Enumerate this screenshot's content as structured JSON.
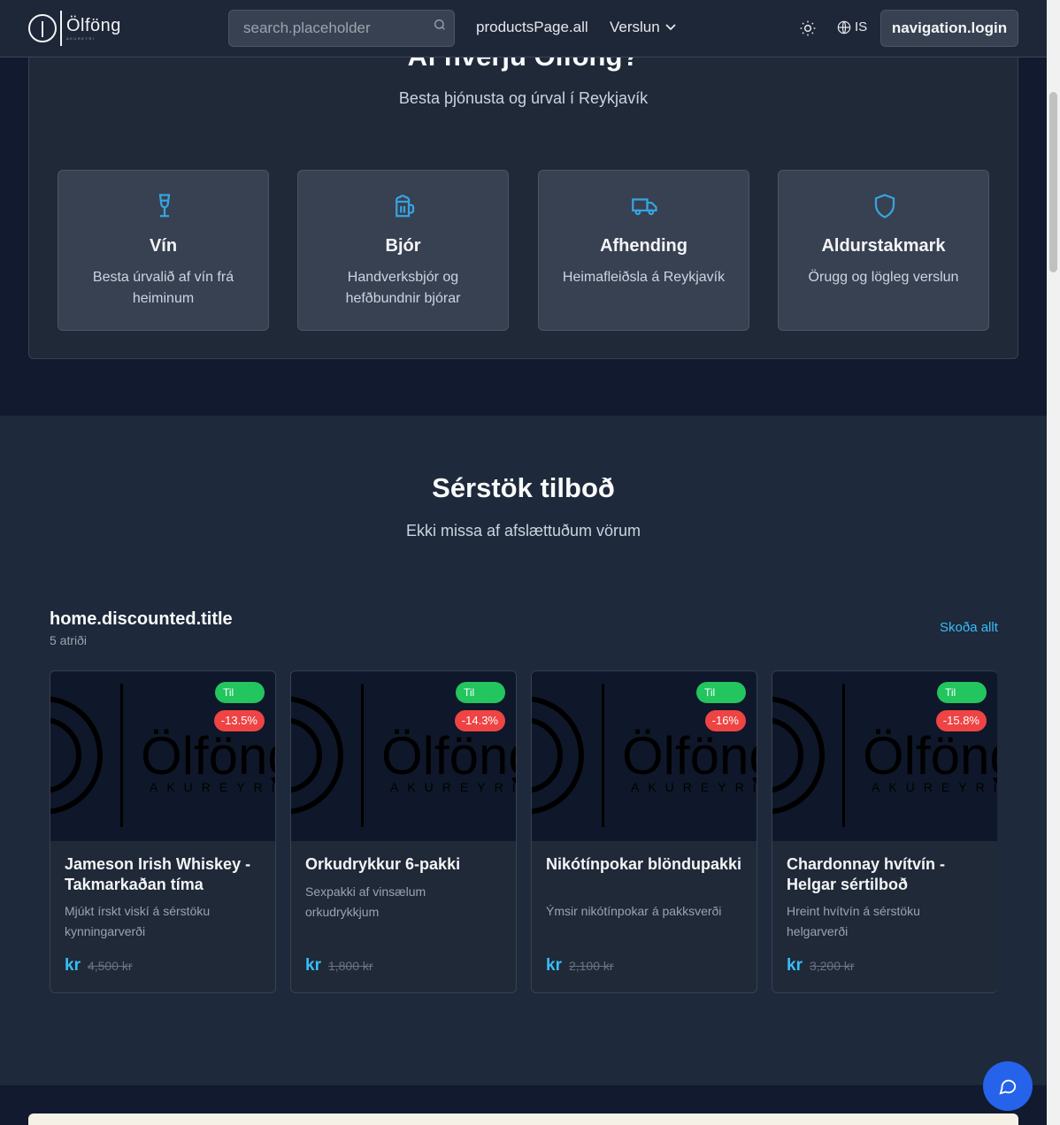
{
  "header": {
    "logo_text": "Ölföng",
    "logo_sub": "AKUREYRI",
    "search_placeholder": "search.placeholder",
    "nav_all": "productsPage.all",
    "nav_shop": "Verslun",
    "lang": "IS",
    "login": "navigation.login",
    "icons": [
      "search-icon",
      "chevron-down-icon",
      "sun-icon",
      "globe-icon"
    ]
  },
  "why": {
    "title": "Af hverju Ölföng?",
    "subtitle": "Besta þjónusta og úrval í Reykjavík",
    "features": [
      {
        "title": "Vín",
        "desc": "Besta úrvalið af vín frá heiminum",
        "icon": "wine-glass-icon"
      },
      {
        "title": "Bjór",
        "desc": "Handverksbjór og hefðbundnir bjórar",
        "icon": "beer-mug-icon"
      },
      {
        "title": "Afhending",
        "desc": "Heimafleiðsla á Reykjavík",
        "icon": "truck-icon"
      },
      {
        "title": "Aldurstakmark",
        "desc": "Örugg og lögleg verslun",
        "icon": "shield-icon"
      }
    ],
    "accent_color": "#38a3e0"
  },
  "offers": {
    "title": "Sérstök tilboð",
    "subtitle": "Ekki missa af afslættuðum vörum",
    "section_title": "home.discounted.title",
    "count": "5 atriði",
    "view_all": "Skoða allt",
    "products": [
      {
        "stock": "Til",
        "discount": "-13.5%",
        "name": "Jameson Irish Whiskey - Takmarkaðan tíma",
        "desc": "Mjúkt írskt viskí á sérstöku kynningarverði",
        "currency": "kr",
        "old_price": "4,500 kr"
      },
      {
        "stock": "Til",
        "discount": "-14.3%",
        "name": "Orkudrykkur 6-pakki",
        "desc": "Sexpakki af vinsælum orkudrykkjum",
        "currency": "kr",
        "old_price": "1,800 kr"
      },
      {
        "stock": "Til",
        "discount": "-16%",
        "name": "Nikótínpokar blöndupakki",
        "desc": "Ýmsir nikótínpokar á pakksverði",
        "currency": "kr",
        "old_price": "2,100 kr"
      },
      {
        "stock": "Til",
        "discount": "-15.8%",
        "name": "Chardonnay hvítvín - Helgar sértilboð",
        "desc": "Hreint hvítvín á sérstöku helgarverði",
        "currency": "kr",
        "old_price": "3,200 kr"
      }
    ],
    "image_logo_text": "Ölföng",
    "image_logo_sub": "AKUREYRI"
  },
  "chat": {
    "icon": "chat-bubble-icon"
  }
}
